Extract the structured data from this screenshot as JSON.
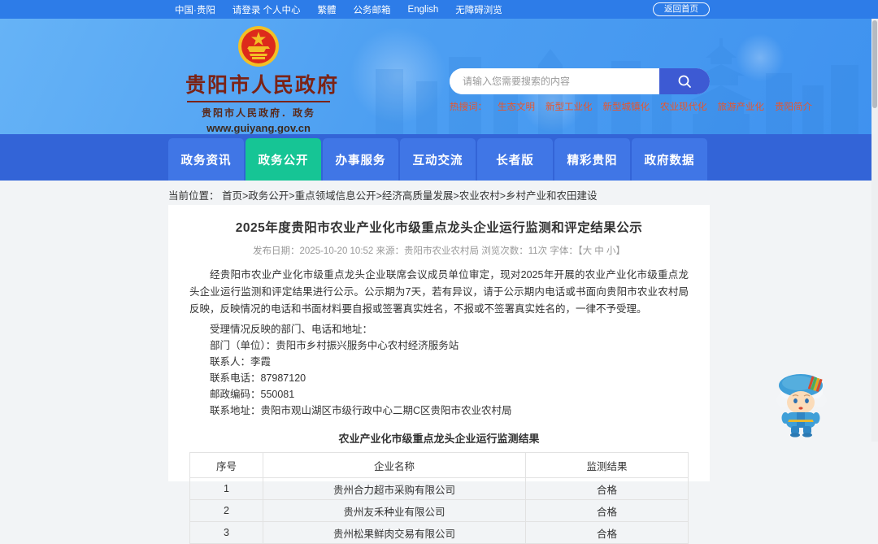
{
  "topbar": {
    "links": [
      "中国·贵阳",
      "请登录 个人中心",
      "繁體",
      "公务邮箱",
      "English",
      "无障碍浏览"
    ],
    "home_button": "返回首页"
  },
  "header": {
    "site_name": "贵阳市人民政府",
    "site_subtitle": "贵阳市人民政府．政务",
    "site_url": "www.guiyang.gov.cn",
    "search": {
      "placeholder": "请输入您需要搜索的内容"
    },
    "hot_search": {
      "label": "热搜词：",
      "keywords": [
        "生态文明",
        "新型工业化",
        "新型城镇化",
        "农业现代化",
        "旅游产业化",
        "贵阳简介"
      ]
    }
  },
  "nav": {
    "items": [
      {
        "label": "政务资讯"
      },
      {
        "label": "政务公开"
      },
      {
        "label": "办事服务"
      },
      {
        "label": "互动交流"
      },
      {
        "label": "长者版"
      },
      {
        "label": "精彩贵阳"
      },
      {
        "label": "政府数据"
      }
    ]
  },
  "breadcrumb": {
    "label": "当前位置：",
    "path": "首页>政务公开>重点领域信息公开>经济高质量发展>农业农村>乡村产业和农田建设"
  },
  "article": {
    "title": "2025年度贵阳市农业产业化市级重点龙头企业运行监测和评定结果公示",
    "meta_text": "发布日期：2025-10-20 10:52  来源：贵阳市农业农村局  浏览次数：11次  字体：",
    "font_sizes": "【大 中 小】",
    "paragraph1": "经贵阳市农业产业化市级重点龙头企业联席会议成员单位审定，现对2025年开展的农业产业化市级重点龙头企业运行监测和评定结果进行公示。公示期为7天，若有异议，请于公示期内电话或书面向贵阳市农业农村局反映，反映情况的电话和书面材料要自报或签署真实姓名，不报或不签署真实姓名的，一律不予受理。",
    "paragraph2": "受理情况反映的部门、电话和地址：",
    "contacts": [
      "部门（单位）：贵阳市乡村振兴服务中心农村经济服务站",
      "联系人：李霞",
      "联系电话：87987120",
      "邮政编码：550081",
      "联系地址：贵阳市观山湖区市级行政中心二期C区贵阳市农业农村局"
    ],
    "table": {
      "caption": "农业产业化市级重点龙头企业运行监测结果",
      "headers": [
        "序号",
        "企业名称",
        "监测结果"
      ],
      "rows": [
        [
          "1",
          "贵州合力超市采购有限公司",
          "合格"
        ],
        [
          "2",
          "贵州友禾种业有限公司",
          "合格"
        ],
        [
          "3",
          "贵州松果鲜肉交易有限公司",
          "合格"
        ]
      ]
    }
  },
  "colors": {
    "topbar_blue": "#2d7ce8",
    "banner_blue": "#4d9ff2",
    "nav_blue": "#3364d7",
    "nav_tab_blue": "#4076e6",
    "nav_active_green": "#16c595",
    "hot_keyword_red": "#e9552b",
    "search_button_blue": "#3d5ad3",
    "logo_maroon": "#7b2316"
  }
}
